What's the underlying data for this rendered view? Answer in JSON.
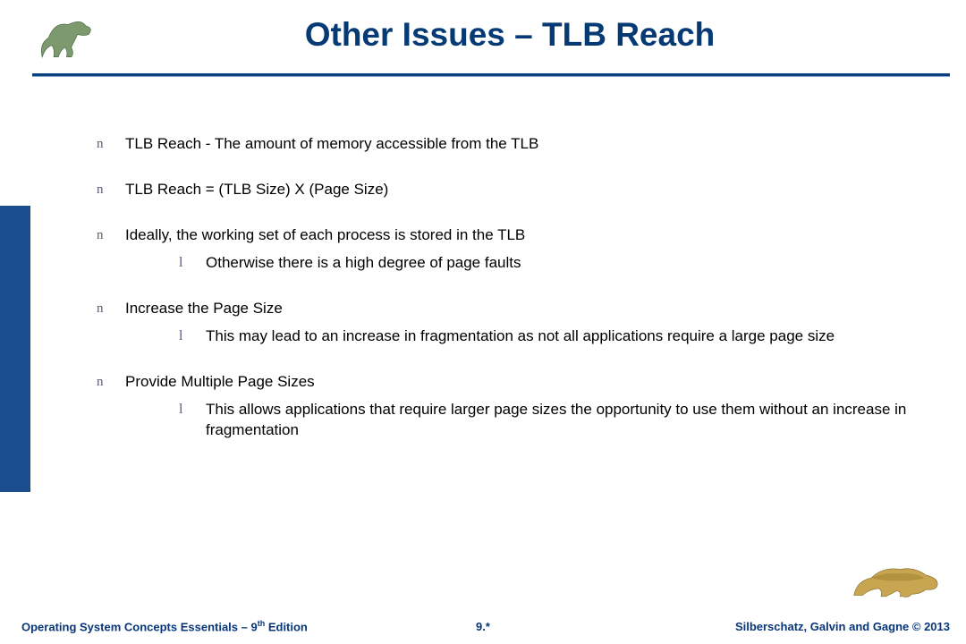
{
  "title": "Other Issues – TLB Reach",
  "bullets": [
    {
      "text": "TLB Reach - The amount of memory accessible from the TLB",
      "children": []
    },
    {
      "text": "TLB Reach = (TLB Size) X (Page Size)",
      "children": []
    },
    {
      "text": "Ideally, the working set of each process is stored in the TLB",
      "children": [
        {
          "text": "Otherwise there is a high degree of page faults"
        }
      ]
    },
    {
      "text": "Increase the Page Size",
      "children": [
        {
          "text": "This may lead to an increase in fragmentation as not all applications require a large page size"
        }
      ]
    },
    {
      "text": "Provide Multiple Page Sizes",
      "children": [
        {
          "text": "This allows applications that require larger page sizes the opportunity to use them without an increase in fragmentation"
        }
      ]
    }
  ],
  "markers": {
    "lvl1": "n",
    "lvl2": "l"
  },
  "footer": {
    "left_a": "Operating System Concepts Essentials – 9",
    "left_sup": "th",
    "left_b": " Edition",
    "center": "9.",
    "center_suffix": "*",
    "right": "Silberschatz, Galvin and Gagne © 2013"
  },
  "icons": {
    "top": "dinosaur-icon",
    "bottom": "dinosaur-icon"
  }
}
